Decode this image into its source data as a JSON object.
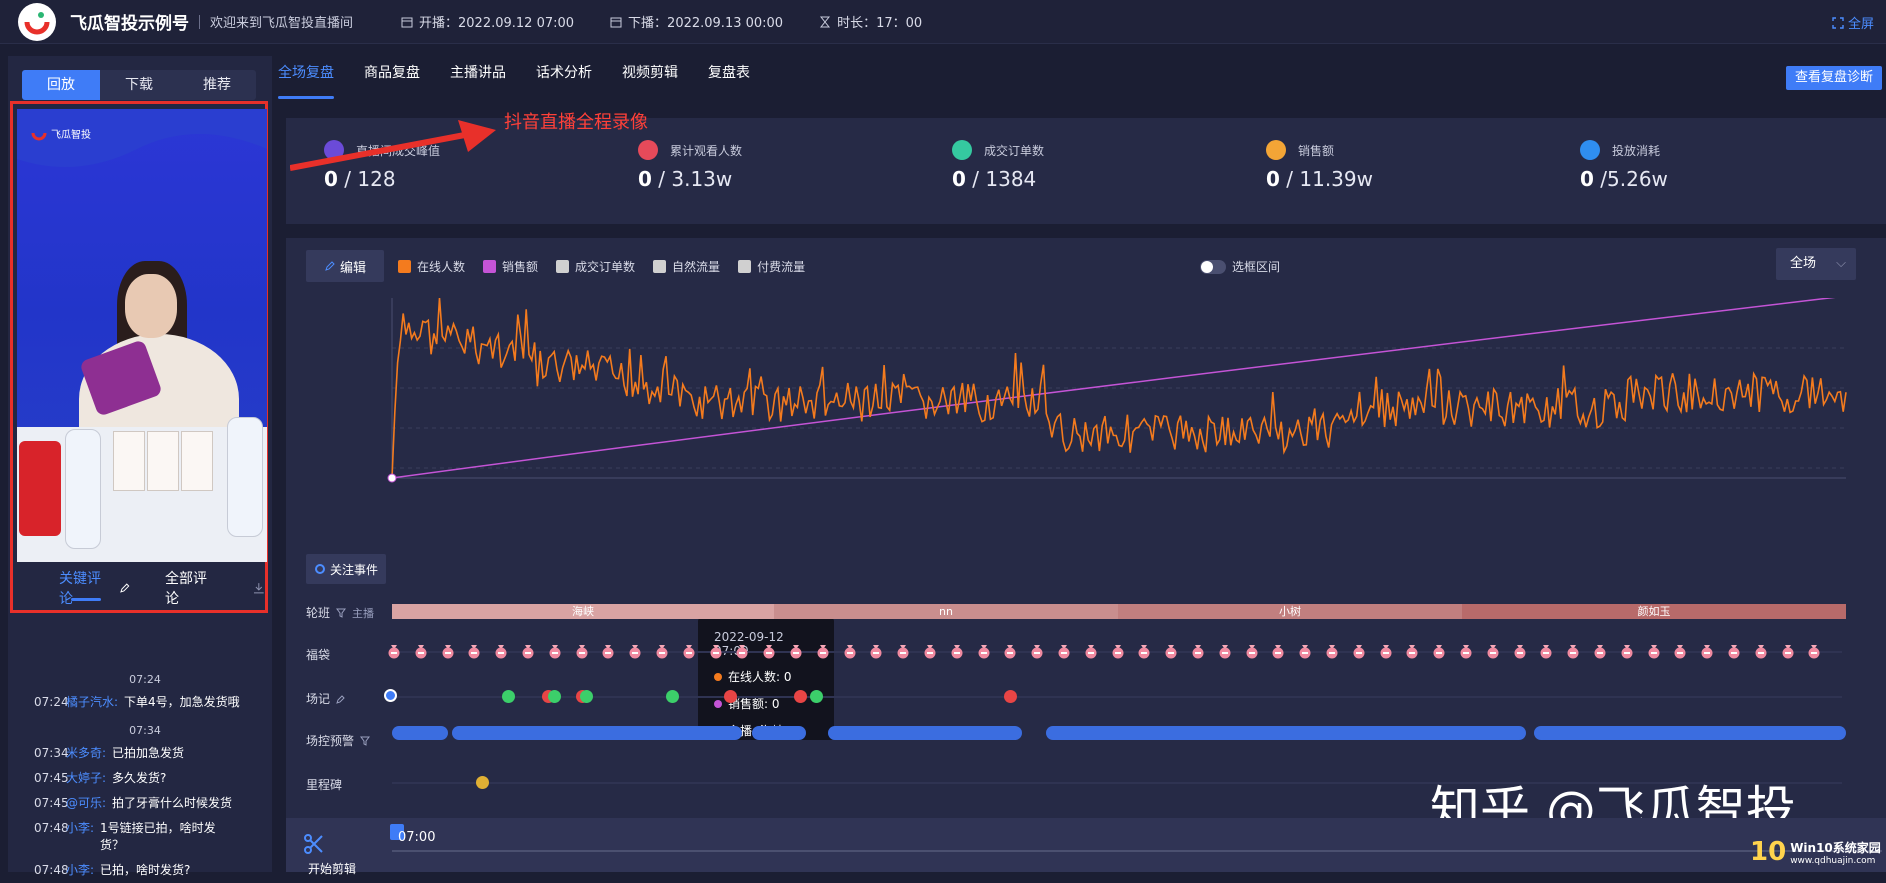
{
  "header": {
    "brand": "飞瓜智投示例号",
    "welcome": "欢迎来到飞瓜智投直播间",
    "start_label": "开播：2022.09.12 07:00",
    "end_label": "下播：2022.09.13 00:00",
    "duration_label": "时长：17：00",
    "fullscreen": "全屏"
  },
  "left": {
    "tabs": [
      "回放",
      "下载",
      "推荐"
    ],
    "comment_tabs": [
      "关键评论",
      "全部评论"
    ],
    "video_logo": "飞瓜智投",
    "chat": [
      {
        "type": "time",
        "text": "07:24"
      },
      {
        "type": "msg",
        "time": "07:24",
        "user": "橘子汽水:",
        "text": "下单4号，加急发货哦"
      },
      {
        "type": "time",
        "text": "07:34"
      },
      {
        "type": "msg",
        "time": "07:34",
        "user": "米多奇:",
        "text": "已拍加急发货"
      },
      {
        "type": "msg",
        "time": "07:45",
        "user": "大婷子:",
        "text": "多久发货?"
      },
      {
        "type": "msg",
        "time": "07:45",
        "user": "@可乐:",
        "text": "拍了牙膏什么时候发货"
      },
      {
        "type": "msg",
        "time": "07:48",
        "user": "小李:",
        "text": "1号链接已拍，啥时发货？"
      },
      {
        "type": "msg",
        "time": "07:48",
        "user": "小李:",
        "text": "已拍，啥时发货?"
      }
    ]
  },
  "tabs": [
    "全场复盘",
    "商品复盘",
    "主播讲品",
    "话术分析",
    "视频剪辑",
    "复盘表"
  ],
  "diagnosis_button": "查看复盘诊断",
  "annotation": "抖音直播全程录像",
  "stats": [
    {
      "label": "直播间成交峰值",
      "value": "0",
      "total": "/ 128",
      "color": "#6b4bd8"
    },
    {
      "label": "累计观看人数",
      "value": "0",
      "total": "/ 3.13w",
      "color": "#e64a5a"
    },
    {
      "label": "成交订单数",
      "value": "0",
      "total": "/ 1384",
      "color": "#35c9a0"
    },
    {
      "label": "销售额",
      "value": "0",
      "total": "/ 11.39w",
      "color": "#f3a536"
    },
    {
      "label": "投放消耗",
      "value": "0",
      "total": "/5.26w",
      "color": "#2f8ef0"
    }
  ],
  "chart_controls": {
    "edit": "编辑",
    "legend": [
      {
        "name": "在线人数",
        "color": "#f47b1e"
      },
      {
        "name": "销售额",
        "color": "#c454d6"
      },
      {
        "name": "成交订单数",
        "color": "#d0d0d0"
      },
      {
        "name": "自然流量",
        "color": "#d0d0d0"
      },
      {
        "name": "付费流量",
        "color": "#d0d0d0"
      }
    ],
    "range_toggle": "选框区间",
    "scope": "全场"
  },
  "chart_data": {
    "type": "line",
    "x_range": [
      "2022-09-12 07:00",
      "2022-09-13 00:00"
    ],
    "series": [
      {
        "name": "在线人数",
        "color": "#f47b1e"
      },
      {
        "name": "销售额",
        "color": "#c454d6"
      }
    ],
    "grid": true
  },
  "tooltip": {
    "time": "2022-09-12 07:00",
    "rows": [
      {
        "label": "在线人数:",
        "value": "0",
        "color": "#f47b1e"
      },
      {
        "label": "销售额:",
        "value": "0",
        "color": "#c454d6"
      },
      {
        "label": "主播:",
        "value": "海峡",
        "color": "#e5b9a8"
      }
    ]
  },
  "events": {
    "button": "关注事件",
    "rows": {
      "shift": "轮班",
      "shift_sub": "主播",
      "bags": "福袋",
      "field": "场记",
      "control": "场控预警",
      "milestone": "里程碑"
    },
    "shifts": [
      "海峡",
      "nn",
      "小树",
      "颜如玉"
    ]
  },
  "bottom": {
    "clip": "开始剪辑",
    "time": "07:00"
  },
  "watermark": "知乎 @飞瓜智投",
  "site_badge": {
    "num": "10",
    "name": "Win10系统家园",
    "url": "www.qdhuajin.com"
  }
}
